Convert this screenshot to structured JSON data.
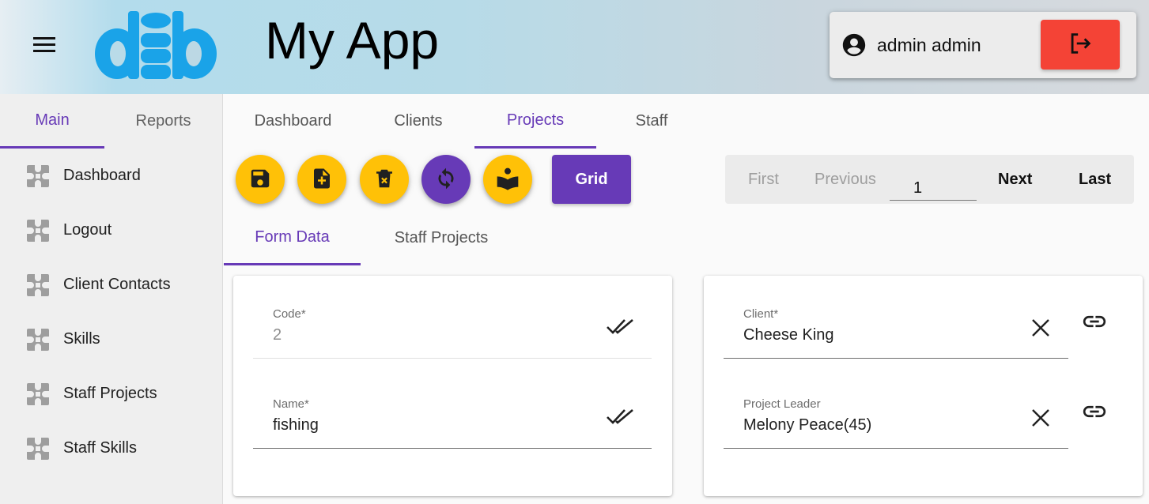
{
  "header": {
    "app_title": "My App",
    "user_name": "admin admin",
    "logo_text": "dib"
  },
  "sidebar": {
    "tabs": [
      {
        "label": "Main",
        "active": true
      },
      {
        "label": "Reports",
        "active": false
      }
    ],
    "items": [
      {
        "label": "Dashboard"
      },
      {
        "label": "Logout"
      },
      {
        "label": "Client Contacts"
      },
      {
        "label": "Skills"
      },
      {
        "label": "Staff Projects"
      },
      {
        "label": "Staff Skills"
      }
    ]
  },
  "main": {
    "tabs": [
      {
        "label": "Dashboard",
        "active": false
      },
      {
        "label": "Clients",
        "active": false
      },
      {
        "label": "Projects",
        "active": true
      },
      {
        "label": "Staff",
        "active": false
      }
    ],
    "toolbar": {
      "grid_label": "Grid"
    },
    "pager": {
      "first": "First",
      "previous": "Previous",
      "page": "1",
      "next": "Next",
      "last": "Last"
    },
    "sub_tabs": [
      {
        "label": "Form Data",
        "active": true
      },
      {
        "label": "Staff Projects",
        "active": false
      }
    ],
    "form_left": {
      "code_label": "Code*",
      "code_value": "2",
      "name_label": "Name*",
      "name_value": "fishing"
    },
    "form_right": {
      "client_label": "Client*",
      "client_value": "Cheese King",
      "leader_label": "Project Leader",
      "leader_value": "Melony Peace(45)"
    }
  },
  "colors": {
    "accent": "#673ab7",
    "fab": "#ffc107",
    "logout": "#f44336",
    "logo": "#1aa3e8"
  },
  "icons": {
    "menu": "hamburger-icon",
    "user": "account-circle-icon",
    "logout": "logout-icon",
    "save": "floppy-disk-icon",
    "new": "file-plus-icon",
    "delete": "file-delete-icon",
    "refresh": "refresh-icon",
    "help": "book-reader-icon",
    "check": "double-check-icon",
    "clear": "close-icon",
    "link": "link-icon"
  }
}
